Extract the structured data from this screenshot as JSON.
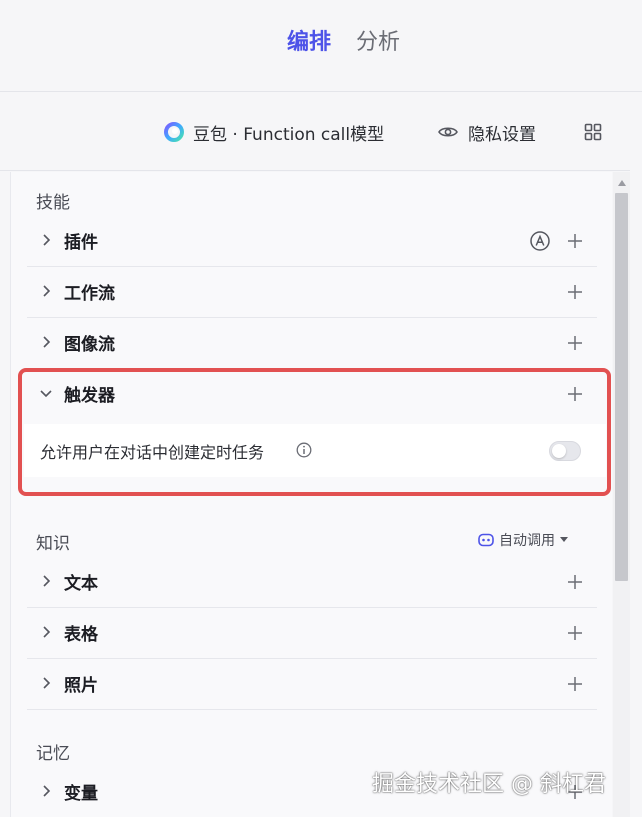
{
  "tabs": {
    "edit": "编排",
    "analysis": "分析"
  },
  "model": {
    "label": "豆包 · Function call模型"
  },
  "privacy": {
    "label": "隐私设置"
  },
  "sections": {
    "skills": "技能",
    "knowledge": "知识",
    "memory": "记忆"
  },
  "skills": {
    "plugins": "插件",
    "workflow": "工作流",
    "imageflow": "图像流",
    "trigger": "触发器"
  },
  "trigger": {
    "allow_text": "允许用户在对话中创建定时任务",
    "toggle_on": false
  },
  "knowledge": {
    "auto_call": "自动调用",
    "text": "文本",
    "table": "表格",
    "photo": "照片"
  },
  "memory": {
    "variables": "变量"
  },
  "watermark": "掘金技术社区 @ 斜杠君",
  "colors": {
    "accent": "#4d53e8",
    "highlight": "#e25151"
  }
}
